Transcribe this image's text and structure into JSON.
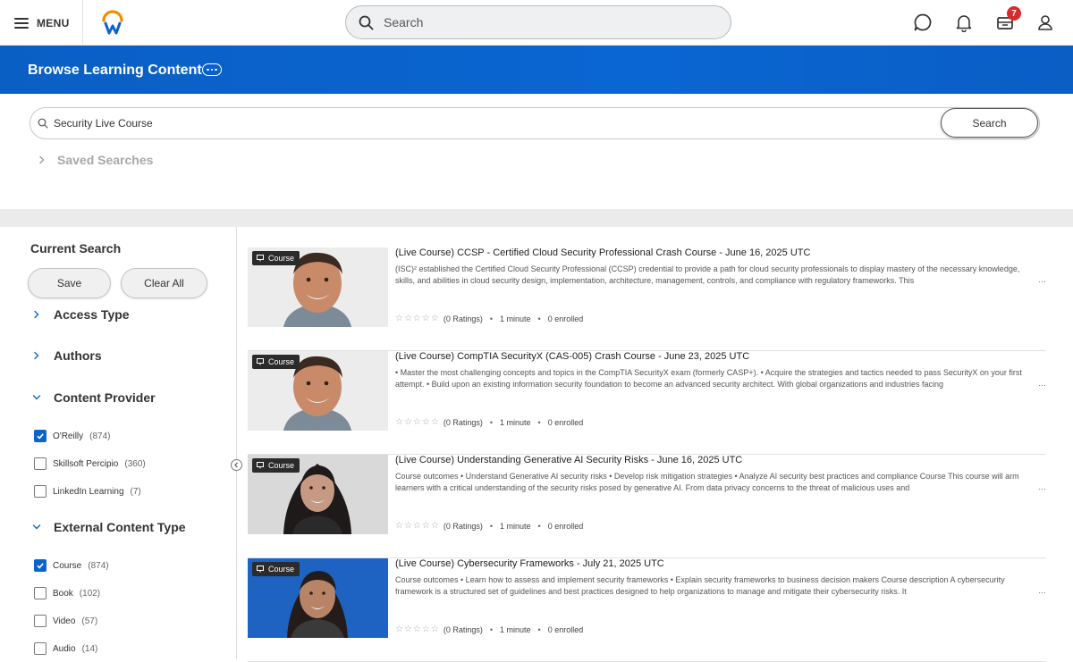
{
  "header": {
    "menu_label": "MENU",
    "search_placeholder": "Search",
    "notifications_badge": "7"
  },
  "banner": {
    "title": "Browse Learning Content"
  },
  "content_search": {
    "value": "Security Live Course",
    "button_label": "Search",
    "saved_searches_label": "Saved Searches"
  },
  "sidebar": {
    "title": "Current Search",
    "save_label": "Save",
    "clear_label": "Clear All",
    "facets": {
      "access_type": "Access Type",
      "authors": "Authors",
      "content_provider": {
        "label": "Content Provider",
        "options": [
          {
            "name": "O'Reilly",
            "count": "(874)",
            "checked": true
          },
          {
            "name": "Skillsoft Percipio",
            "count": "(360)",
            "checked": false
          },
          {
            "name": "LinkedIn Learning",
            "count": "(7)",
            "checked": false
          }
        ]
      },
      "external_content_type": {
        "label": "External Content Type",
        "options": [
          {
            "name": "Course",
            "count": "(874)",
            "checked": true
          },
          {
            "name": "Book",
            "count": "(102)",
            "checked": false
          },
          {
            "name": "Video",
            "count": "(57)",
            "checked": false
          },
          {
            "name": "Audio",
            "count": "(14)",
            "checked": false
          }
        ]
      }
    }
  },
  "results": [
    {
      "tag": "Course",
      "title": "(Live Course) CCSP - Certified Cloud Security Professional Crash Course - June 16, 2025 UTC",
      "description": "(ISC)² established the Certified Cloud Security Professional (CCSP) credential to provide a path for cloud security professionals to display mastery of the necessary knowledge, skills, and abilities in cloud security design, implementation, architecture, management, controls, and compliance with regulatory frameworks. This",
      "ratings": "(0 Ratings)",
      "duration": "1 minute",
      "enrolled": "0 enrolled"
    },
    {
      "tag": "Course",
      "title": "(Live Course) CompTIA SecurityX (CAS-005) Crash Course - June 23, 2025 UTC",
      "description": "• Master the most challenging concepts and topics in the CompTIA SecurityX exam (formerly CASP+). • Acquire the strategies and tactics needed to pass SecurityX on your first attempt. • Build upon an existing information security foundation to become an advanced security architect. With global organizations and industries facing",
      "ratings": "(0 Ratings)",
      "duration": "1 minute",
      "enrolled": "0 enrolled"
    },
    {
      "tag": "Course",
      "title": "(Live Course) Understanding Generative AI Security Risks - June 16, 2025 UTC",
      "description": "Course outcomes • Understand Generative AI security risks • Develop risk mitigation strategies • Analyze AI security best practices and compliance Course This course will arm learners with a critical understanding of the security risks posed by generative AI. From data privacy concerns to the threat of malicious uses and",
      "ratings": "(0 Ratings)",
      "duration": "1 minute",
      "enrolled": "0 enrolled"
    },
    {
      "tag": "Course",
      "title": "(Live Course) Cybersecurity Frameworks - July 21, 2025 UTC",
      "description": "Course outcomes • Learn how to assess and implement security frameworks • Explain security frameworks to business decision makers Course description A cybersecurity framework is a structured set of guidelines and best practices designed to help organizations to manage and mitigate their cybersecurity risks. It",
      "ratings": "(0 Ratings)",
      "duration": "1 minute",
      "enrolled": "0 enrolled"
    }
  ],
  "colors": {
    "brand_blue": "#0a63cc",
    "badge_red": "#d62b2b"
  },
  "icons": [
    "menu-icon",
    "workday-logo",
    "search-icon",
    "chat-icon",
    "bell-icon",
    "inbox-icon",
    "profile-icon",
    "more-icon",
    "chevron-right-icon",
    "chevron-down-icon",
    "checkbox-icon",
    "course-icon",
    "star-icon"
  ]
}
